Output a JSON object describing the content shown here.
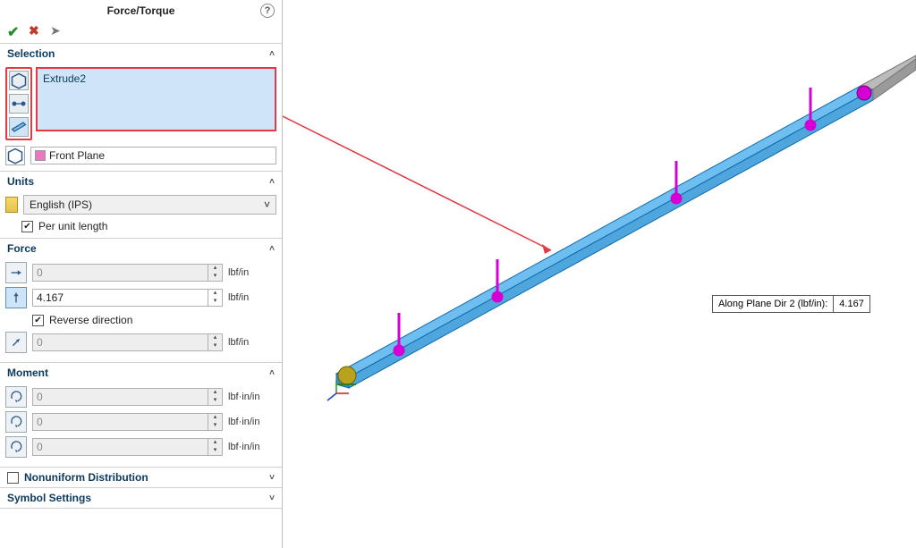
{
  "header": {
    "title": "Force/Torque"
  },
  "sections": {
    "selection": {
      "title": "Selection",
      "selected_item": "Extrude2",
      "reference_plane": "Front Plane"
    },
    "units": {
      "title": "Units",
      "system": "English (IPS)",
      "per_unit_length_label": "Per unit length",
      "per_unit_length_checked": true
    },
    "force": {
      "title": "Force",
      "dir1_value": "0",
      "dir1_unit": "lbf/in",
      "dir2_value": "4.167",
      "dir2_unit": "lbf/in",
      "reverse_label": "Reverse direction",
      "reverse_checked": true,
      "normal_value": "0",
      "normal_unit": "lbf/in"
    },
    "moment": {
      "title": "Moment",
      "m1_value": "0",
      "m1_unit": "lbf·in/in",
      "m2_value": "0",
      "m2_unit": "lbf·in/in",
      "m3_value": "0",
      "m3_unit": "lbf·in/in"
    },
    "nonuniform": {
      "title": "Nonuniform Distribution",
      "checked": false
    },
    "symbol": {
      "title": "Symbol Settings"
    }
  },
  "callout": {
    "label": "Along Plane Dir 2 (lbf/in):",
    "value": "4.167"
  },
  "colors": {
    "highlight_border": "#e63946",
    "beam_fill": "#6fbef0",
    "beam_stroke": "#0d6bb0",
    "load_marker": "#d400d4",
    "ref_plane": "#e879c1"
  }
}
